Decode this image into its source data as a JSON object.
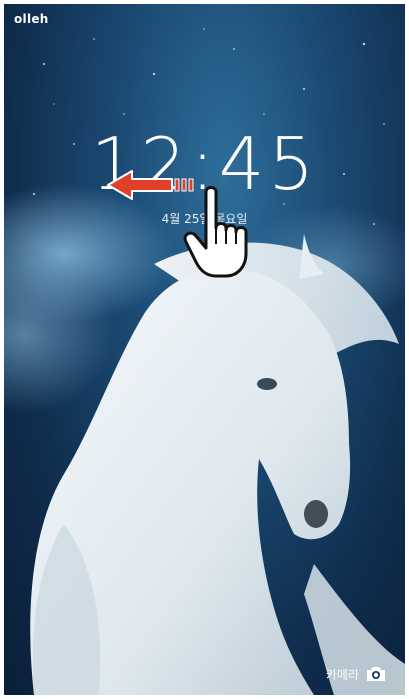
{
  "status_bar": {
    "carrier": "olleh"
  },
  "lock_screen": {
    "time_hours": "12",
    "time_separator": ":",
    "time_minutes": "45",
    "date": "4월 25일 목요일",
    "camera_label": "카메라"
  },
  "overlay": {
    "arrow_icon": "arrow-left-icon",
    "hand_icon": "pointing-hand-icon",
    "arrow_color": "#e0402a"
  },
  "colors": {
    "sky_top": "#0a1f38",
    "sky_glow": "#2e6e9a",
    "horse": "#e9eff3"
  }
}
